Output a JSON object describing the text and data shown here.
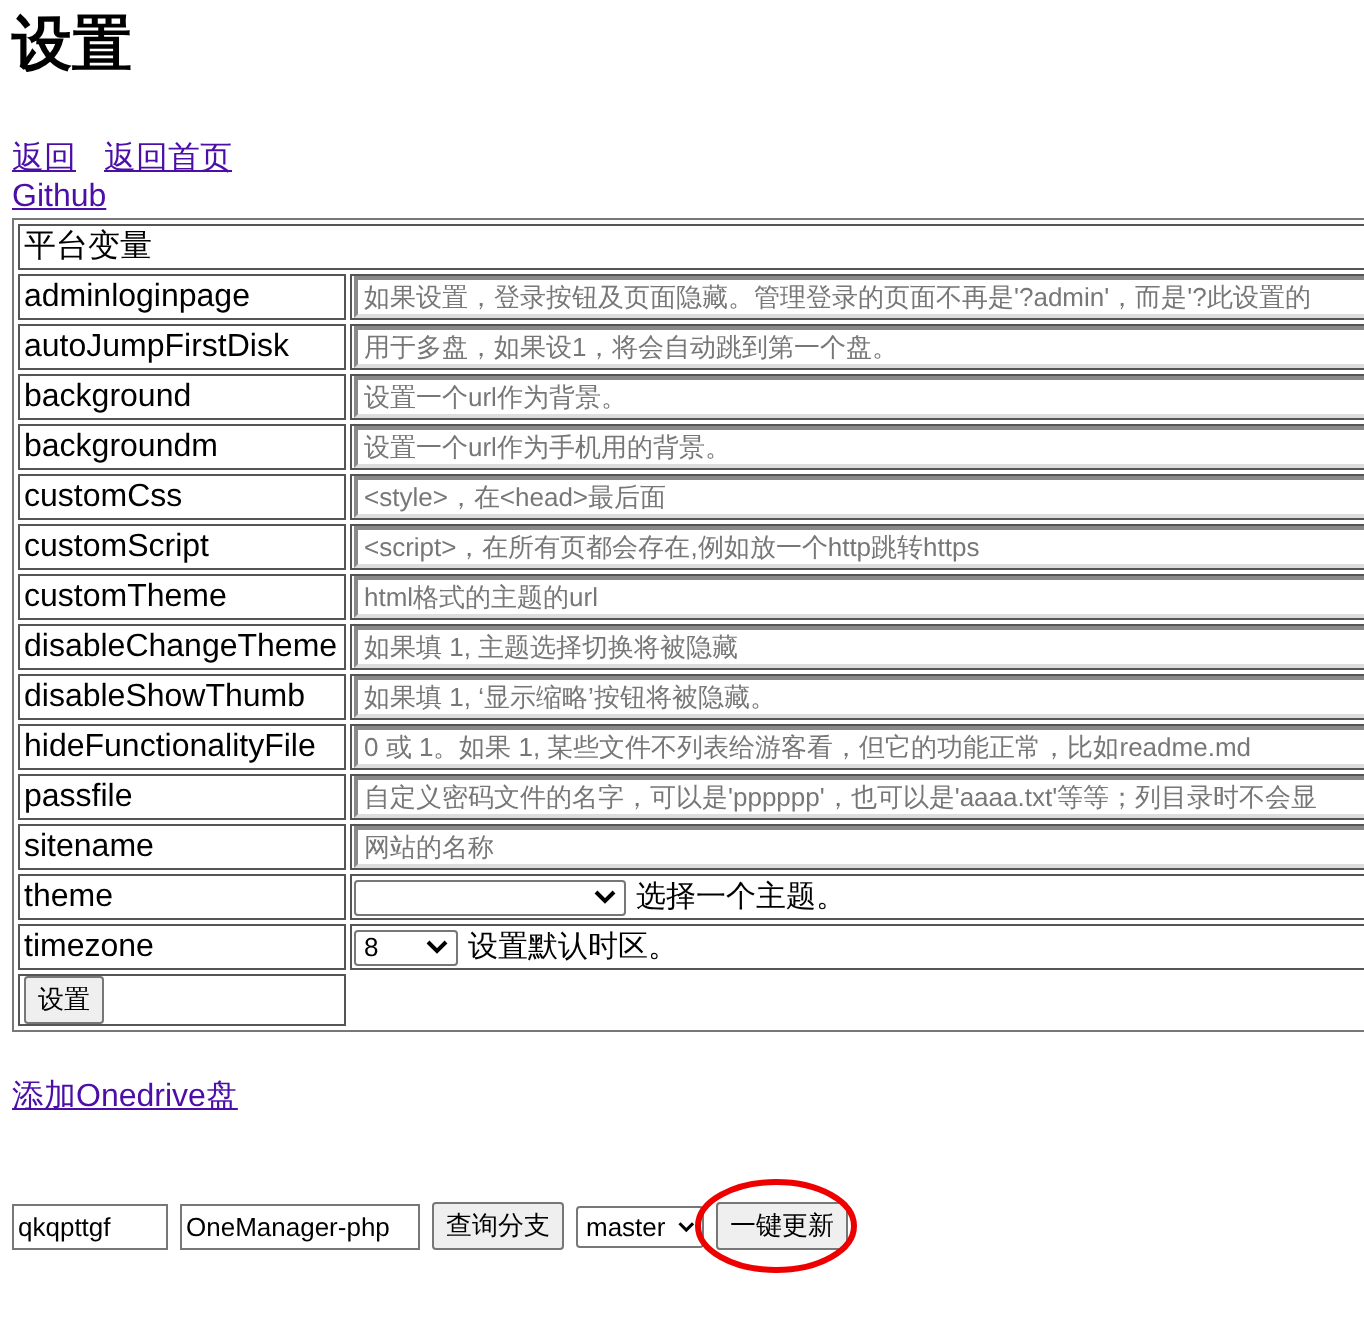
{
  "title": "设置",
  "links": [
    {
      "text": "返回"
    },
    {
      "text": "返回首页"
    }
  ],
  "github_link": "Github",
  "table": {
    "header": "平台变量",
    "rows": [
      {
        "kind": "text",
        "name": "adminloginpage",
        "placeholder": "如果设置，登录按钮及页面隐藏。管理登录的页面不再是'?admin'，而是'?此设置的"
      },
      {
        "kind": "text",
        "name": "autoJumpFirstDisk",
        "placeholder": "用于多盘，如果设1，将会自动跳到第一个盘。"
      },
      {
        "kind": "text",
        "name": "background",
        "placeholder": "设置一个url作为背景。"
      },
      {
        "kind": "text",
        "name": "backgroundm",
        "placeholder": "设置一个url作为手机用的背景。"
      },
      {
        "kind": "text",
        "name": "customCss",
        "placeholder": "<style>，在<head>最后面"
      },
      {
        "kind": "text",
        "name": "customScript",
        "placeholder": "<script>，在所有页都会存在,例如放一个http跳转https"
      },
      {
        "kind": "text",
        "name": "customTheme",
        "placeholder": "html格式的主题的url"
      },
      {
        "kind": "text",
        "name": "disableChangeTheme",
        "placeholder": "如果填 1, 主题选择切换将被隐藏"
      },
      {
        "kind": "text",
        "name": "disableShowThumb",
        "placeholder": "如果填 1, ‘显示缩略’按钮将被隐藏。"
      },
      {
        "kind": "text",
        "name": "hideFunctionalityFile",
        "placeholder": "0 或 1。如果 1, 某些文件不列表给游客看，但它的功能正常，比如readme.md"
      },
      {
        "kind": "text",
        "name": "passfile",
        "placeholder": "自定义密码文件的名字，可以是'pppppp'，也可以是'aaaa.txt'等等；列目录时不会显"
      },
      {
        "kind": "text",
        "name": "sitename",
        "placeholder": "网站的名称"
      },
      {
        "kind": "select",
        "name": "theme",
        "note": "选择一个主题。"
      },
      {
        "kind": "select",
        "name": "timezone",
        "value": "8",
        "note": "设置默认时区。"
      }
    ],
    "submit": "设置"
  },
  "add_link": "添加Onedrive盘",
  "update": {
    "user": "qkqpttgf",
    "repo": "OneManager-php",
    "query_button": "查询分支",
    "branch": "master",
    "update_button": "一键更新"
  }
}
